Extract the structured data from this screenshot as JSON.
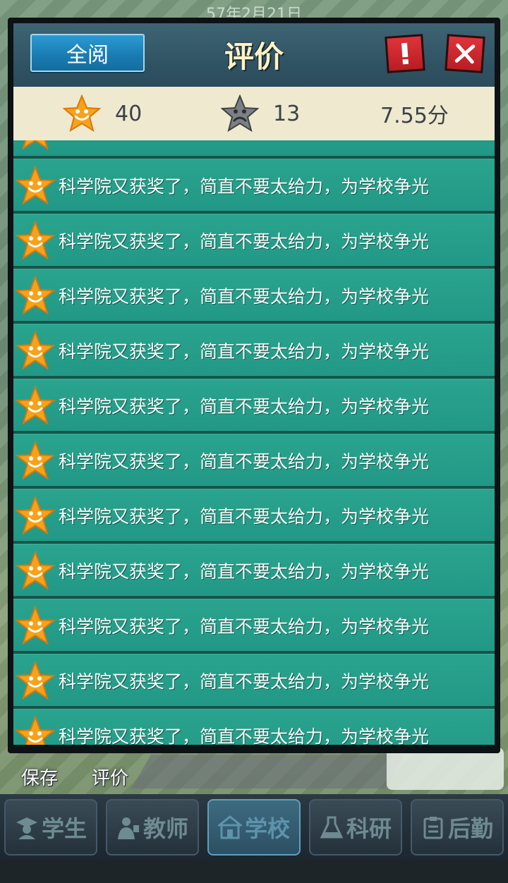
{
  "background": {
    "date_text": "57年2月21日",
    "actions": [
      {
        "label": "保存",
        "icon": "save-icon"
      },
      {
        "label": "评价",
        "icon": "review-icon"
      }
    ]
  },
  "dialog": {
    "title": "评价",
    "read_all_label": "全阅",
    "alert_label": "!",
    "close_label": "✕",
    "summary": {
      "good_count": "40",
      "bad_count": "13",
      "score": "7.55分"
    },
    "reviews": [
      {
        "sentiment": "good",
        "text": "科学院又获奖了，简直不要太给力，为学校争光"
      },
      {
        "sentiment": "good",
        "text": "科学院又获奖了，简直不要太给力，为学校争光"
      },
      {
        "sentiment": "good",
        "text": "科学院又获奖了，简直不要太给力，为学校争光"
      },
      {
        "sentiment": "good",
        "text": "科学院又获奖了，简直不要太给力，为学校争光"
      },
      {
        "sentiment": "good",
        "text": "科学院又获奖了，简直不要太给力，为学校争光"
      },
      {
        "sentiment": "good",
        "text": "科学院又获奖了，简直不要太给力，为学校争光"
      },
      {
        "sentiment": "good",
        "text": "科学院又获奖了，简直不要太给力，为学校争光"
      },
      {
        "sentiment": "good",
        "text": "科学院又获奖了，简直不要太给力，为学校争光"
      },
      {
        "sentiment": "good",
        "text": "科学院又获奖了，简直不要太给力，为学校争光"
      },
      {
        "sentiment": "good",
        "text": "科学院又获奖了，简直不要太给力，为学校争光"
      },
      {
        "sentiment": "good",
        "text": "科学院又获奖了，简直不要太给力，为学校争光"
      },
      {
        "sentiment": "good",
        "text": "科学院又获奖了，简直不要太给力，为学校争光"
      }
    ]
  },
  "bottom_nav": [
    {
      "label": "学生",
      "icon": "student-icon",
      "active": false
    },
    {
      "label": "教师",
      "icon": "teacher-icon",
      "active": false
    },
    {
      "label": "学校",
      "icon": "school-icon",
      "active": true
    },
    {
      "label": "科研",
      "icon": "flask-icon",
      "active": false
    },
    {
      "label": "后勤",
      "icon": "clipboard-icon",
      "active": false
    }
  ],
  "colors": {
    "row_green": "#229886",
    "header_teal": "#2f5262",
    "summary_cream": "#efe9cf",
    "title_cream": "#fff3c7",
    "button_blue": "#1b7db4",
    "button_red": "#b81d24",
    "star_orange": "#f7a21a",
    "star_gray": "#7b8084"
  }
}
